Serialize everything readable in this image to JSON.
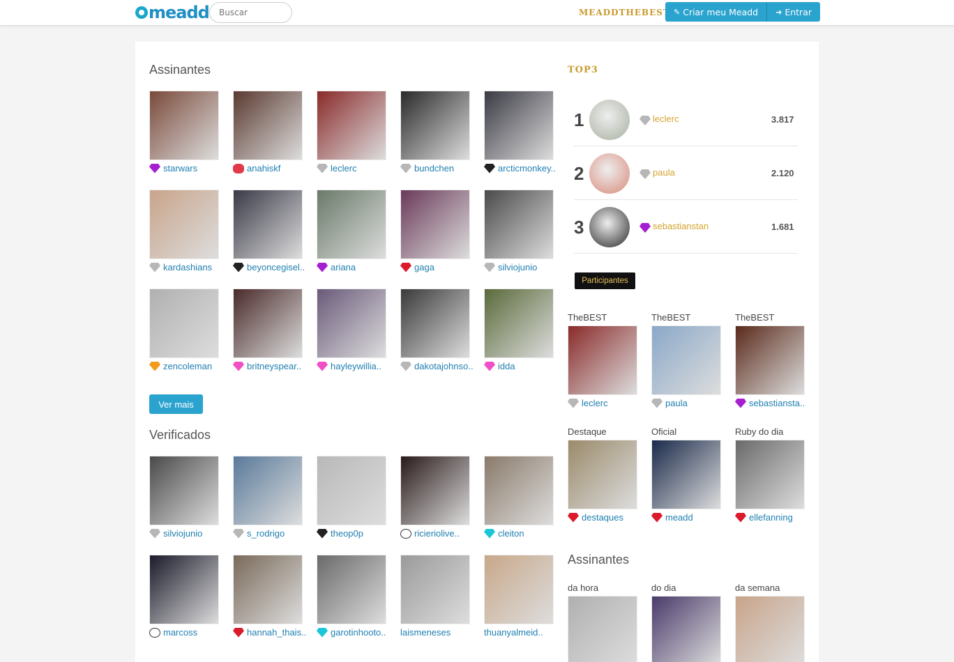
{
  "header": {
    "logo_text": "meadd",
    "search_placeholder": "Buscar",
    "brand": "MEADDTHEBEST",
    "create_label": "Criar meu Meadd",
    "login_label": "Entrar"
  },
  "subscribers": {
    "title": "Assinantes",
    "items": [
      {
        "name": "starwars",
        "badge": "purple",
        "color": "#7a4a3a"
      },
      {
        "name": "anahiskf",
        "badge": "bull",
        "color": "#5a3a30"
      },
      {
        "name": "leclerc",
        "badge": "gray",
        "color": "#8a2a2a"
      },
      {
        "name": "bundchen",
        "badge": "gray",
        "color": "#2a2a2a"
      },
      {
        "name": "arcticmonkey..",
        "badge": "black",
        "color": "#3a3a44"
      },
      {
        "name": "kardashians",
        "badge": "gray",
        "color": "#c8a48a"
      },
      {
        "name": "beyoncegisel..",
        "badge": "black",
        "color": "#3a3a48"
      },
      {
        "name": "ariana",
        "badge": "purple",
        "color": "#6a7a6a"
      },
      {
        "name": "gaga",
        "badge": "red",
        "color": "#6a3a5a"
      },
      {
        "name": "silviojunio",
        "badge": "gray",
        "color": "#4a4a4a"
      },
      {
        "name": "zencoleman",
        "badge": "orange",
        "color": "#b0b0b0"
      },
      {
        "name": "britneyspear..",
        "badge": "pink",
        "color": "#4a2a2a"
      },
      {
        "name": "hayleywillia..",
        "badge": "pink",
        "color": "#6a5a7a"
      },
      {
        "name": "dakotajohnso..",
        "badge": "gray",
        "color": "#3a3a3a"
      },
      {
        "name": "idda",
        "badge": "pink",
        "color": "#5a6a3a"
      }
    ],
    "more_label": "Ver mais"
  },
  "verified": {
    "title": "Verificados",
    "items": [
      {
        "name": "silviojunio",
        "badge": "gray",
        "color": "#4a4a4a"
      },
      {
        "name": "s_rodrigo",
        "badge": "gray",
        "color": "#5a7a9a"
      },
      {
        "name": "theop0p",
        "badge": "black",
        "color": "#b8b8b8"
      },
      {
        "name": "ricieriolive..",
        "badge": "face",
        "color": "#2a1a1a"
      },
      {
        "name": "cleiton",
        "badge": "cyan",
        "color": "#8a7a6a"
      },
      {
        "name": "marcoss",
        "badge": "face",
        "color": "#1a1a2a"
      },
      {
        "name": "hannah_thais..",
        "badge": "red",
        "color": "#7a6a5a"
      },
      {
        "name": "garotinhooto..",
        "badge": "cyan",
        "color": "#6a6a6a"
      },
      {
        "name": "laismeneses",
        "badge": "",
        "color": "#9a9a9a"
      },
      {
        "name": "thuanyalmeid..",
        "badge": "",
        "color": "#c8a88a"
      }
    ]
  },
  "top3": {
    "title": "TOP3",
    "rows": [
      {
        "rank": "1",
        "name": "leclerc",
        "score": "3.817",
        "badge": "gray",
        "color": "#a8b0a0"
      },
      {
        "rank": "2",
        "name": "paula",
        "score": "2.120",
        "badge": "gray",
        "color": "#d88a7a"
      },
      {
        "rank": "3",
        "name": "sebastianstan",
        "score": "1.681",
        "badge": "purple",
        "color": "#2a2a2a"
      }
    ],
    "participants_label": "Participantes"
  },
  "featured": [
    {
      "label": "TheBEST",
      "name": "leclerc",
      "badge": "gray",
      "color": "#8a2a2a"
    },
    {
      "label": "TheBEST",
      "name": "paula",
      "badge": "gray",
      "color": "#8aa8c8"
    },
    {
      "label": "TheBEST",
      "name": "sebastiansta..",
      "badge": "purple",
      "color": "#5a2a1a"
    },
    {
      "label": "Destaque",
      "name": "destaques",
      "badge": "red",
      "color": "#9a8a6a"
    },
    {
      "label": "Oficial",
      "name": "meadd",
      "badge": "red",
      "color": "#1a2a4a"
    },
    {
      "label": "Ruby do dia",
      "name": "ellefanning",
      "badge": "red",
      "color": "#6a6a6a"
    }
  ],
  "side_subscribers": {
    "title": "Assinantes",
    "items": [
      {
        "label": "da hora",
        "color": "#b0b0b0"
      },
      {
        "label": "do dia",
        "color": "#4a3a6a"
      },
      {
        "label": "da semana",
        "color": "#c8a48a"
      }
    ]
  }
}
